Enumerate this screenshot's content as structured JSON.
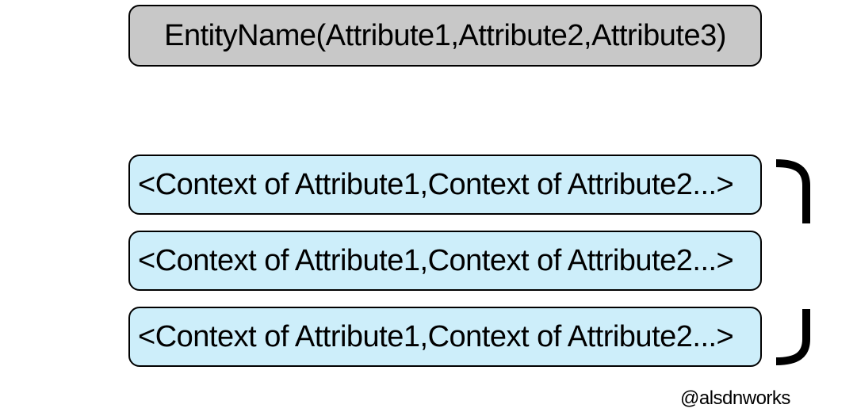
{
  "entity": {
    "label": "EntityName(Attribute1,Attribute2,Attribute3)",
    "fill": "#c8c8c8"
  },
  "contexts": [
    {
      "label": "<Context of Attribute1,Context of Attribute2...>"
    },
    {
      "label": "<Context of Attribute1,Context of Attribute2...>"
    },
    {
      "label": "<Context of Attribute1,Context of Attribute2...>"
    }
  ],
  "context_fill": "#cdeefa",
  "brace_icon": "right-curly-brace",
  "credit": "@alsdnworks"
}
